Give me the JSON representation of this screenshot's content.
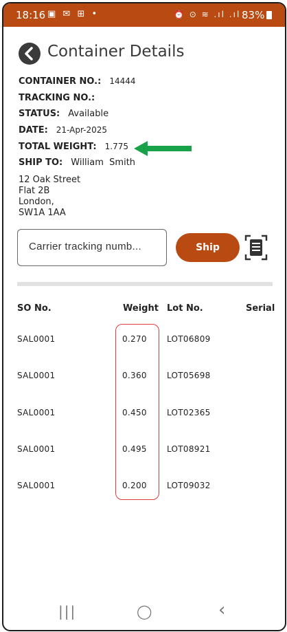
{
  "status_bar": {
    "time": "18:16",
    "left_icons": "▣ ✉ ⊞ •",
    "right_icons": "⏰ ⊙ ≋ .ıl .ıl",
    "battery": "83%"
  },
  "header": {
    "title": "Container Details"
  },
  "details": {
    "container_no_label": "CONTAINER NO.:",
    "container_no": "14444",
    "tracking_no_label": "TRACKING NO.:",
    "tracking_no": "",
    "status_label": "STATUS:",
    "status": "Available",
    "date_label": "DATE:",
    "date": "21-Apr-2025",
    "total_weight_label": "TOTAL WEIGHT:",
    "total_weight": "1.775",
    "ship_to_label": "SHIP TO:",
    "ship_to": "William  Smith",
    "address": [
      "12 Oak Street",
      "Flat 2B",
      "London,",
      "SW1A 1AA"
    ]
  },
  "shipping": {
    "tracking_placeholder": "Carrier tracking numb...",
    "ship_label": "Ship",
    "scan_icon": "scan-icon"
  },
  "table": {
    "headers": [
      "SO No.",
      "Weight",
      "Lot No.",
      "Serial"
    ],
    "rows": [
      {
        "so": "SAL0001",
        "weight": "0.270",
        "lot": "LOT06809",
        "serial": ""
      },
      {
        "so": "SAL0001",
        "weight": "0.360",
        "lot": "LOT05698",
        "serial": ""
      },
      {
        "so": "SAL0001",
        "weight": "0.450",
        "lot": "LOT02365",
        "serial": ""
      },
      {
        "so": "SAL0001",
        "weight": "0.495",
        "lot": "LOT08921",
        "serial": ""
      },
      {
        "so": "SAL0001",
        "weight": "0.200",
        "lot": "LOT09032",
        "serial": ""
      }
    ]
  },
  "nav_bar": {
    "recents": "|||",
    "home": "◯",
    "back": "‹"
  },
  "colors": {
    "brand": "#b84a12",
    "annotation_arrow": "#1aa24a",
    "annotation_box": "#e23a3a"
  }
}
